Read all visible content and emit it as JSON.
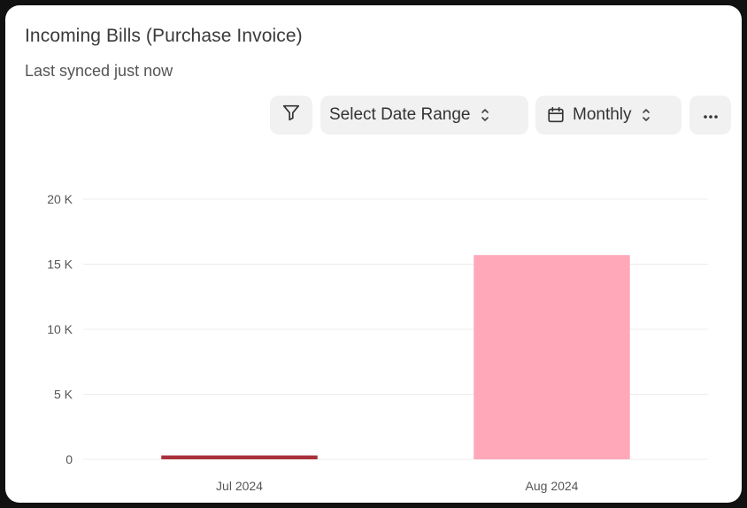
{
  "card": {
    "title": "Incoming Bills (Purchase Invoice)",
    "subtitle": "Last synced just now"
  },
  "controls": {
    "filter_icon": "filter-icon",
    "date_range_label": "Select Date Range",
    "interval_icon": "calendar-icon",
    "interval_label": "Monthly",
    "more_icon": "ellipsis-icon"
  },
  "chart_data": {
    "type": "bar",
    "categories": [
      "Jul 2024",
      "Aug 2024"
    ],
    "values": [
      300,
      15700
    ],
    "colors": [
      "#a8323c",
      "#ffa8ba"
    ],
    "ylim": [
      0,
      20000
    ],
    "yticks": [
      {
        "value": 0,
        "label": "0"
      },
      {
        "value": 5000,
        "label": "5 K"
      },
      {
        "value": 10000,
        "label": "10 K"
      },
      {
        "value": 15000,
        "label": "15 K"
      },
      {
        "value": 20000,
        "label": "20 K"
      }
    ],
    "grid": true,
    "title": "",
    "xlabel": "",
    "ylabel": ""
  }
}
